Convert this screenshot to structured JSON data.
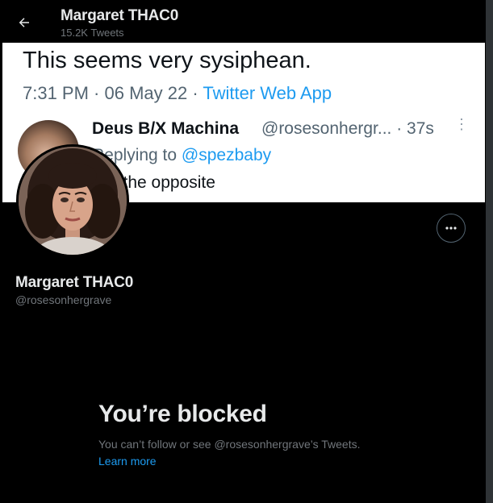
{
  "header": {
    "display_name": "Margaret THAC0",
    "tweet_count": "15.2K Tweets"
  },
  "banner": {
    "tweet_text": "This seems very sysiphean.",
    "time": "7:31 PM · 06 May 22 · ",
    "app": "Twitter Web App",
    "reply_name": "Deus B/X Machina",
    "reply_handle": "@rosesonhergr... · 37s",
    "replying_prefix": "Replying to ",
    "replying_to": "@spezbaby",
    "reply_body": "No, the opposite"
  },
  "profile": {
    "display_name": "Margaret THAC0",
    "handle": "@rosesonhergrave"
  },
  "blocked": {
    "title": "You’re blocked",
    "description": "You can’t follow or see @rosesonhergrave’s Tweets.",
    "learn_more": "Learn more"
  },
  "icons": {
    "back": "arrow-left-icon",
    "more": "more-horizontal-icon"
  },
  "colors": {
    "background": "#000000",
    "link": "#1d9bf0",
    "secondary_text": "#71767b"
  }
}
